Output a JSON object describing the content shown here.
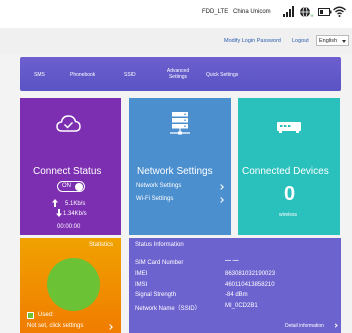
{
  "status_bar": {
    "network_type": "FDD_LTE",
    "carrier": "China Unicom",
    "icons": [
      "signal-bars-icon",
      "globe-roaming-icon",
      "battery-icon",
      "wifi-icon"
    ]
  },
  "account": {
    "modify_password": "Modify Login Password",
    "logout": "Logout",
    "language": "English"
  },
  "menu": {
    "items": [
      "SMS",
      "Phonebook",
      "SSID",
      "Advanced Settings",
      "Quick Settings"
    ]
  },
  "connect_status": {
    "title": "Connect Status",
    "toggle": "ON",
    "upload": "5.1Kb/s",
    "download": "1.34Kb/s",
    "duration": "00:00:00"
  },
  "network_settings": {
    "title": "Network Settings",
    "links": [
      "Network Settings",
      "Wi-Fi Settings"
    ]
  },
  "connected_devices": {
    "title": "Connected Devices",
    "count": "0",
    "label": "wireless"
  },
  "statistics": {
    "title": "Statistics",
    "used_label": "Used:",
    "not_set": "Not set, click settings"
  },
  "status_info": {
    "title": "Status Information",
    "rows": [
      {
        "label": "SIM Card Number",
        "value": "— —"
      },
      {
        "label": "IMEI",
        "value": "863081032190023"
      },
      {
        "label": "IMSI",
        "value": "460110413858210"
      },
      {
        "label": "Signal Strength",
        "value": "-84 dBm"
      },
      {
        "label": "Network Name（SSID）",
        "value": "MI_0CD2B1"
      }
    ],
    "detail_link": "Detail information"
  },
  "colors": {
    "menu": "#5a54c4",
    "connect_tile": "#7d2fb2",
    "network_tile": "#4b8fcf",
    "devices_tile": "#2ac1bd",
    "stats_tile": "#f07c00",
    "status_tile": "#6d63cf",
    "pie": "#6cc235"
  }
}
